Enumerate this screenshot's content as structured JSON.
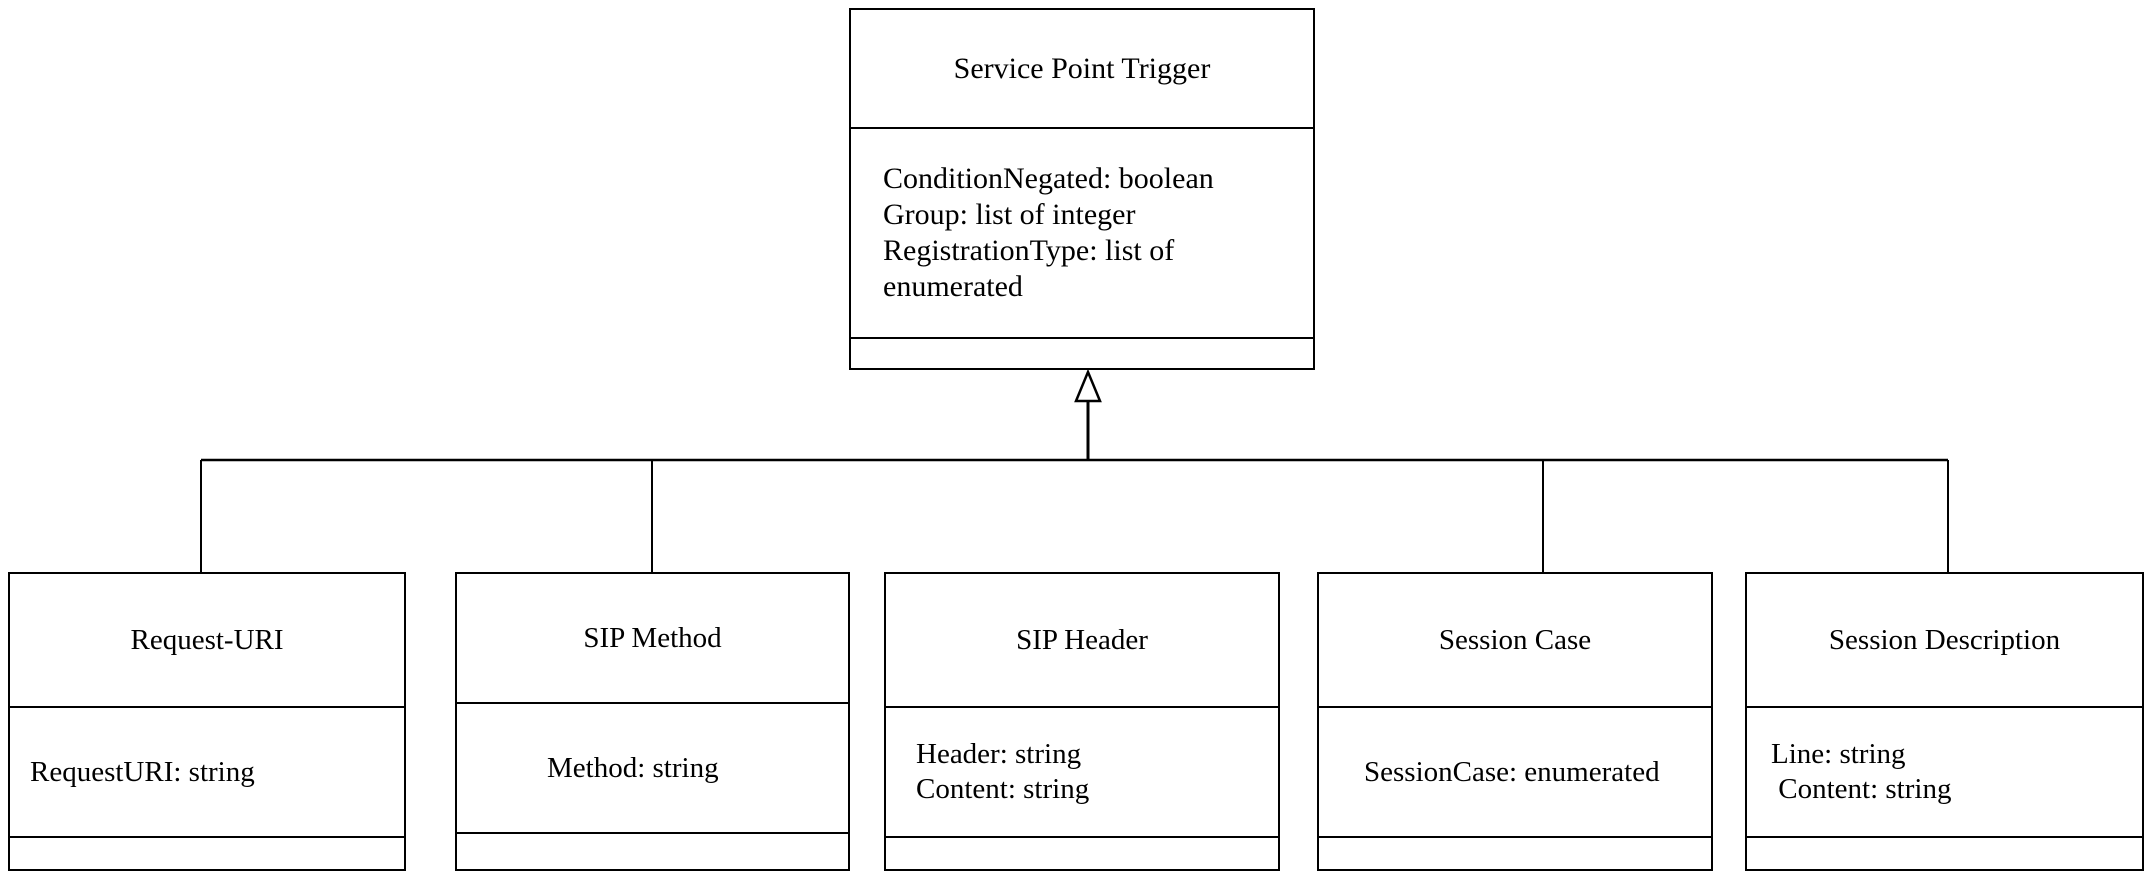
{
  "diagram": {
    "type": "UML class diagram (generalization)",
    "parent": {
      "name": "Service Point Trigger",
      "attributes": [
        "ConditionNegated: boolean",
        "Group: list of integer",
        "RegistrationType: list of",
        "enumerated"
      ],
      "operations": []
    },
    "children": [
      {
        "name": "Request-URI",
        "attributes": [
          "RequestURI: string"
        ],
        "operations": []
      },
      {
        "name": "SIP Method",
        "attributes": [
          "Method: string"
        ],
        "operations": []
      },
      {
        "name": "SIP Header",
        "attributes": [
          "Header: string",
          "Content: string"
        ],
        "operations": []
      },
      {
        "name": "Session Case",
        "attributes": [
          "SessionCase: enumerated"
        ],
        "operations": []
      },
      {
        "name": "Session Description",
        "attributes": [
          "Line: string",
          " Content: string"
        ],
        "operations": []
      }
    ],
    "relationship": "generalization (hollow triangle arrow to parent)",
    "colors": {
      "line": "#000000",
      "background": "#ffffff"
    }
  }
}
